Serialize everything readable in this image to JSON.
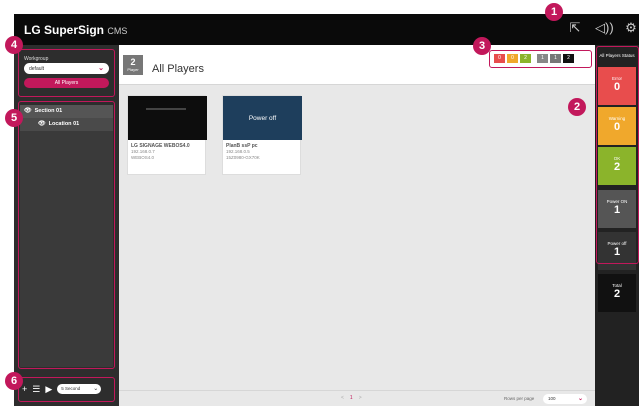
{
  "app": {
    "logo": "LG SuperSign",
    "logo_suffix": "CMS"
  },
  "topbar": {
    "icons": [
      "export-icon",
      "speaker-icon",
      "gear-icon"
    ]
  },
  "sidebar": {
    "workgroup_label": "Workgroup",
    "workgroup_value": "default",
    "all_players_button": "All Players",
    "tree": [
      {
        "label": "Section 01"
      },
      {
        "label": "Location 01"
      }
    ],
    "bottom_tools": {
      "speed_value": "5 Second"
    }
  },
  "header": {
    "count": "2",
    "count_label": "Player",
    "title": "All Players",
    "chips": [
      {
        "value": "0",
        "color": "#e84d4d"
      },
      {
        "value": "0",
        "color": "#f0a82c"
      },
      {
        "value": "2",
        "color": "#8bb42b"
      },
      {
        "value": "1",
        "color": "#888888"
      },
      {
        "value": "1",
        "color": "#777777"
      },
      {
        "value": "2",
        "color": "#111111"
      }
    ]
  },
  "players": [
    {
      "name": "LG SIGNAGE WEBOS4.0",
      "ip": "192.168.0.7",
      "model": "WEBOS4.0",
      "overlay": ""
    },
    {
      "name": "PlanB ssP pc",
      "ip": "192.168.0.5",
      "model": "15Z0980-GX70K",
      "overlay": "Power off"
    }
  ],
  "footer": {
    "pager_prev": "<",
    "pager_current": "1",
    "pager_next": ">",
    "rows_label": "Rows per page",
    "rows_value": "100"
  },
  "status_panel": {
    "title": "All Players Status",
    "items": [
      {
        "label": "Error",
        "value": "0",
        "color": "#e84d4d"
      },
      {
        "label": "Warning",
        "value": "0",
        "color": "#f0a82c"
      },
      {
        "label": "OK",
        "value": "2",
        "color": "#8bb42b"
      },
      {
        "label": "Power ON",
        "value": "1",
        "color": "#555555"
      },
      {
        "label": "Power off",
        "value": "1",
        "color": "#333333"
      },
      {
        "label": "Total",
        "value": "2",
        "color": "#111111"
      }
    ]
  },
  "callouts": [
    "1",
    "2",
    "3",
    "4",
    "5",
    "6"
  ]
}
